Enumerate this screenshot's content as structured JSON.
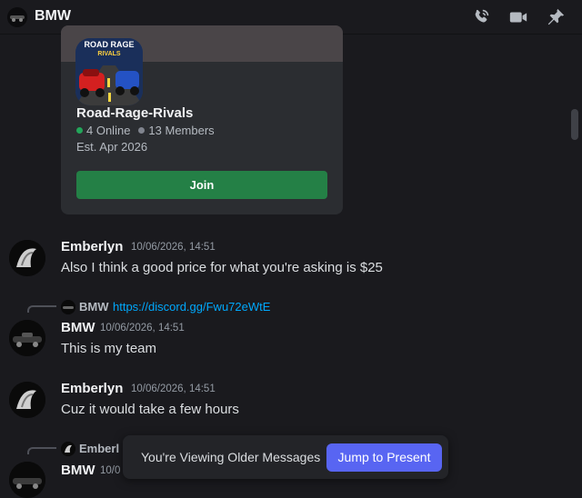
{
  "header": {
    "title": "BMW",
    "icons": [
      "phone-icon",
      "video-icon",
      "pin-icon"
    ]
  },
  "invite": {
    "banner_text": "ROAD RAGE",
    "banner_subtext": "RIVALS",
    "server_name": "Road-Rage-Rivals",
    "online": "4 Online",
    "members": "13 Members",
    "established": "Est. Apr 2026",
    "join_label": "Join",
    "online_color": "#23a55a",
    "members_color": "#80848e"
  },
  "messages": [
    {
      "author": "Emberlyn",
      "timestamp": "10/06/2026, 14:51",
      "content": "Also I think a good price for what you're asking is $25"
    },
    {
      "reply_author": "BMW",
      "reply_text": "https://discord.gg/Fwu72eWtE",
      "author": "BMW",
      "timestamp": "10/06/2026, 14:51",
      "content": "This is my team"
    },
    {
      "author": "Emberlyn",
      "timestamp": "10/06/2026, 14:51",
      "content": "Cuz it would take a few hours"
    },
    {
      "reply_author": "Emberl",
      "author": "BMW",
      "timestamp": "10/0"
    }
  ],
  "older_bar": {
    "text": "You're Viewing Older Messages",
    "jump_label": "Jump to Present"
  },
  "colors": {
    "background": "#1a1a1e",
    "accent": "#5865f2",
    "join_green": "#248046",
    "link": "#00a8fc"
  }
}
